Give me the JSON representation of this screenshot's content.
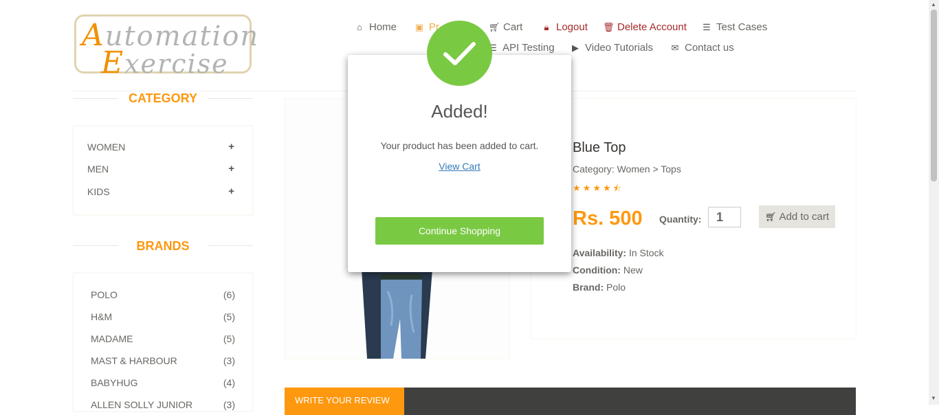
{
  "logo": {
    "line1_cap": "A",
    "line1_rest": "utomation",
    "line2_cap": "E",
    "line2_rest": "xercise"
  },
  "nav": {
    "home": "Home",
    "products": "Pr",
    "cart": "Cart",
    "logout": "Logout",
    "delete_account": "Delete Account",
    "test_cases": "Test Cases",
    "api_testing": "API Testing",
    "video_tutorials": "Video Tutorials",
    "contact_us": "Contact us"
  },
  "sidebar": {
    "category_title": "CATEGORY",
    "categories": [
      {
        "label": "WOMEN",
        "expand": "+"
      },
      {
        "label": "MEN",
        "expand": "+"
      },
      {
        "label": "KIDS",
        "expand": "+"
      }
    ],
    "brands_title": "BRANDS",
    "brands": [
      {
        "label": "POLO",
        "count": "(6)"
      },
      {
        "label": "H&M",
        "count": "(5)"
      },
      {
        "label": "MADAME",
        "count": "(5)"
      },
      {
        "label": "MAST & HARBOUR",
        "count": "(3)"
      },
      {
        "label": "BABYHUG",
        "count": "(4)"
      },
      {
        "label": "ALLEN SOLLY JUNIOR",
        "count": "(3)"
      }
    ]
  },
  "product": {
    "name": "Blue Top",
    "category": "Category: Women > Tops",
    "rating": 4.5,
    "price": "Rs. 500",
    "quantity_label": "Quantity:",
    "quantity_value": "1",
    "add_to_cart": "Add to cart",
    "availability_label": "Availability:",
    "availability_value": "In Stock",
    "condition_label": "Condition:",
    "condition_value": "New",
    "brand_label": "Brand:",
    "brand_value": "Polo"
  },
  "review": {
    "tab_label": "WRITE YOUR REVIEW"
  },
  "modal": {
    "title": "Added!",
    "message": "Your product has been added to cart.",
    "view_cart": "View Cart",
    "continue_button": "Continue Shopping"
  },
  "colors": {
    "accent": "#fe980f",
    "success": "#7ac943",
    "danger": "#a52a2a",
    "dark_bar": "#40403e"
  }
}
